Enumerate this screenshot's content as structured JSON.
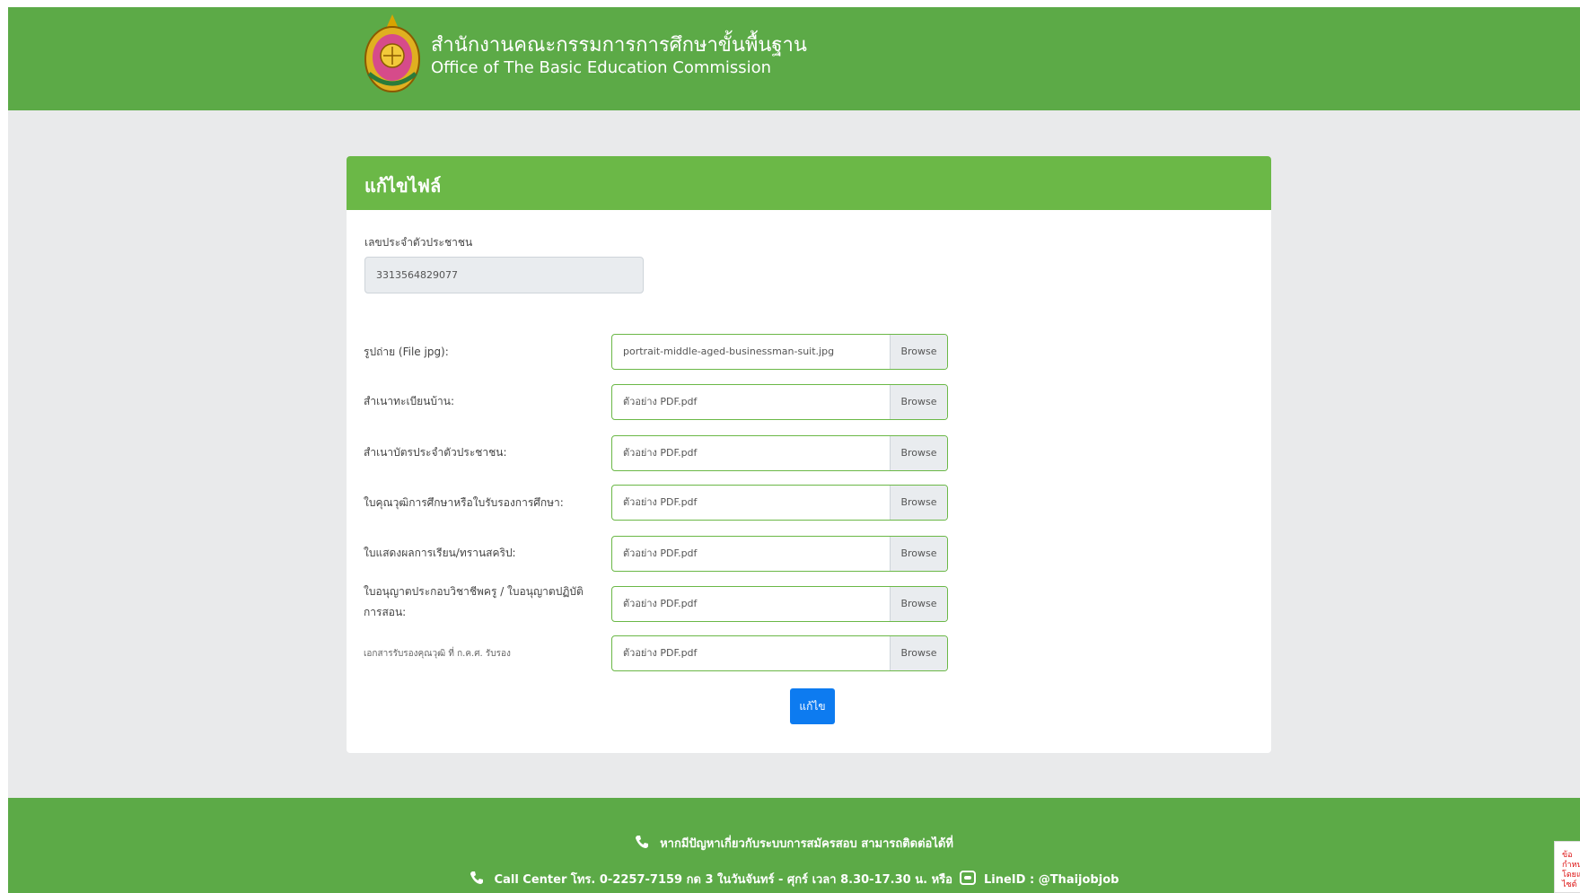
{
  "header": {
    "title_th": "สำนักงานคณะกรรมการการศึกษาขั้นพื้นฐาน",
    "title_en": "Office of The Basic Education Commission",
    "logo_icon": "obec-emblem-icon",
    "bg_color": "#5caa47"
  },
  "card": {
    "title": "แก้ไขไฟล์",
    "id_label": "เลขประจำตัวประชาชน",
    "id_value": "3313564829077",
    "rows": [
      {
        "label": "รูปถ่าย (File jpg):",
        "file": "portrait-middle-aged-businessman-suit.jpg",
        "browse": "Browse"
      },
      {
        "label": "สำเนาทะเบียนบ้าน:",
        "file": "ตัวอย่าง PDF.pdf",
        "browse": "Browse"
      },
      {
        "label": "สำเนาบัตรประจำตัวประชาชน:",
        "file": "ตัวอย่าง PDF.pdf",
        "browse": "Browse"
      },
      {
        "label": "ใบคุณวุฒิการศึกษาหรือใบรับรองการศึกษา:",
        "file": "ตัวอย่าง PDF.pdf",
        "browse": "Browse"
      },
      {
        "label": "ใบแสดงผลการเรียน/ทรานสคริป:",
        "file": "ตัวอย่าง PDF.pdf",
        "browse": "Browse"
      },
      {
        "label": "ใบอนุญาตประกอบวิชาชีพครู / ใบอนุญาตปฏิบัติการสอน:",
        "file": "ตัวอย่าง PDF.pdf",
        "browse": "Browse"
      },
      {
        "label": "เอกสารรับรองคุณวุฒิ ที่ ก.ค.ศ. รับรอง",
        "file": "ตัวอย่าง PDF.pdf",
        "browse": "Browse"
      }
    ],
    "submit_label": "แก้ไข",
    "header_color": "#6bb847",
    "submit_color": "#0d7bf0"
  },
  "footer": {
    "line1": "หากมีปัญหาเกี่ยวกับระบบการสมัครสอบ สามารถติดต่อได้ที่",
    "line2_before": "Call Center โทร. 0-2257-7159 กด 3 ในวันจันทร์ - ศุกร์ เวลา 8.30-17.30 น. หรือ",
    "line2_after": "LineID : @Thaijobjob",
    "phone_icon": "phone-icon",
    "line_icon": "line-app-icon"
  },
  "corner_badge": "ข้อกำหนด โดยแ ไซต์"
}
